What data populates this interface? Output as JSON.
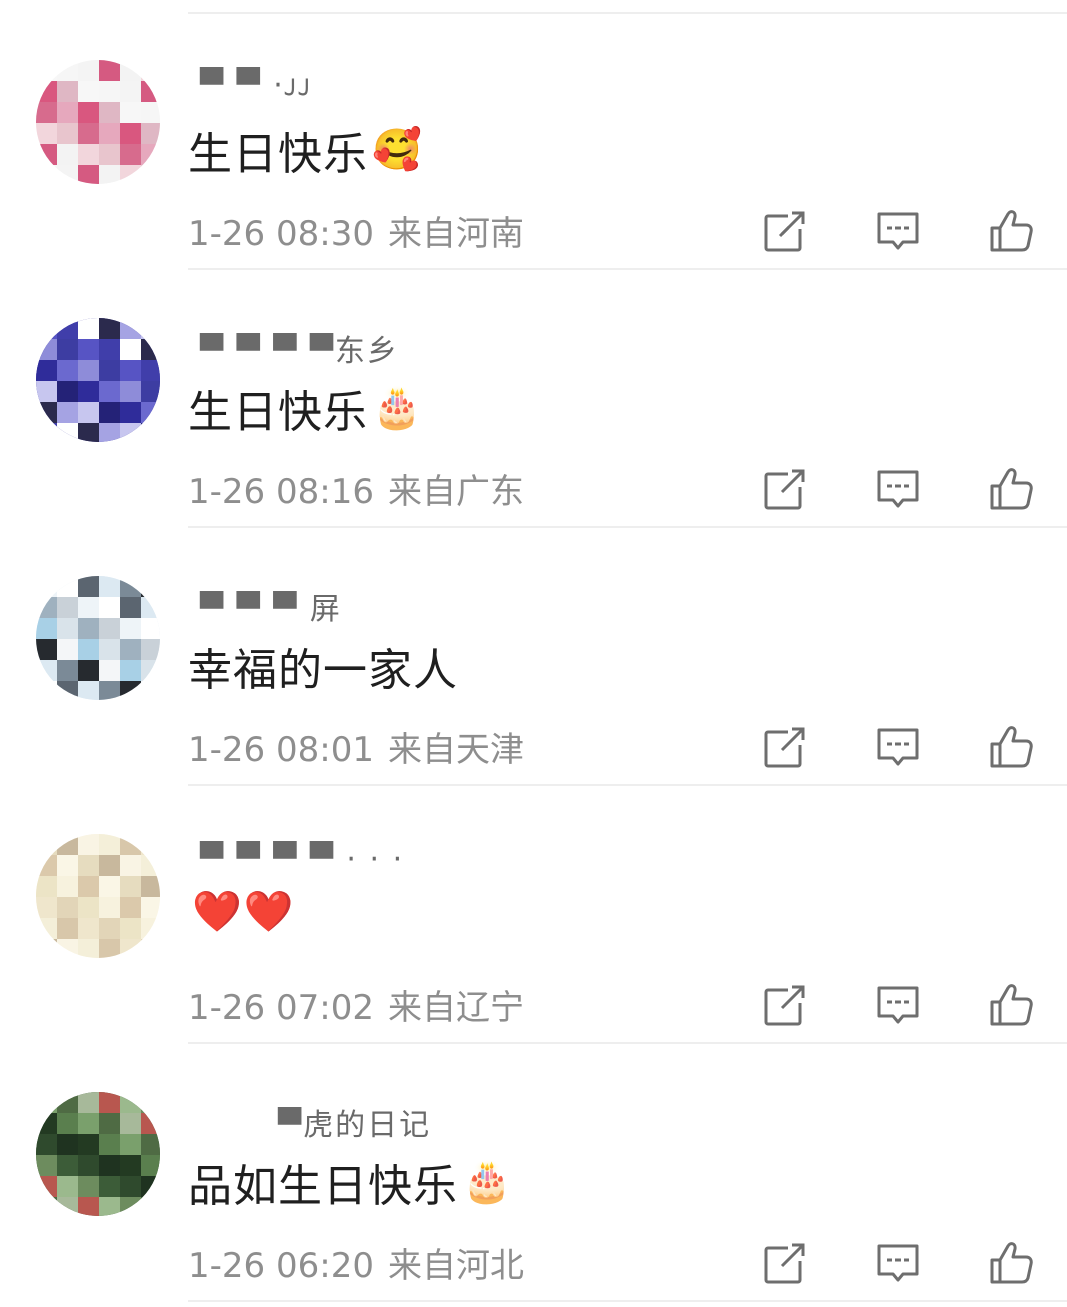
{
  "comments": [
    {
      "username": "▀ ▀ ·ᴊᴊ",
      "text": "生日快乐",
      "emoji": "🥰",
      "time": "1-26 08:30",
      "location": "来自河南",
      "avatar_colors": [
        "#f7f7f7",
        "#f3f3f3",
        "#e6a8bd",
        "#f6f6f6",
        "#f2d6dc",
        "#d9577f",
        "#f4f4f4",
        "#e8c5cd",
        "#dfb7c4",
        "#d55a81",
        "#d76b8d"
      ]
    },
    {
      "username": "▀ ▀ ▀ ▀东乡",
      "text": "生日快乐",
      "emoji": "🎂",
      "time": "1-26 08:16",
      "location": "来自广东",
      "avatar_colors": [
        "#2f2c9a",
        "#5754c4",
        "#a5a3e3",
        "#6b69cf",
        "#403eaa",
        "#c7c6ef",
        "#8e8cd9",
        "#ffffff",
        "#242277",
        "#3d3da2",
        "#2b2a4d"
      ]
    },
    {
      "username": "▀ ▀ ▀ 屏",
      "text": "幸福的一家人",
      "emoji": "",
      "time": "1-26 08:01",
      "location": "来自天津",
      "avatar_colors": [
        "#dce9f2",
        "#a8d0e6",
        "#eef4f8",
        "#7b8a97",
        "#d9e3ea",
        "#ffffff",
        "#262a2f",
        "#9fb1bf",
        "#5b6570",
        "#f4f6f8",
        "#c9d1d8"
      ]
    },
    {
      "username": "▀ ▀ ▀ ▀ · · ·",
      "text": "",
      "emoji": "❤️❤️",
      "time": "1-26 07:02",
      "location": "来自辽宁",
      "avatar_colors": [
        "#faf6e6",
        "#f4efd9",
        "#ece4c6",
        "#e6dcbf",
        "#d8c7aa",
        "#f7f2de",
        "#c8b89d",
        "#efe6cc",
        "#dbc9ab",
        "#f9f4e4",
        "#e2d5b8"
      ]
    },
    {
      "username": "▀虎的日记",
      "text": "品如生日快乐",
      "emoji": "🎂",
      "time": "1-26 06:20",
      "location": "来自河北",
      "avatar_colors": [
        "#3c5c38",
        "#5a7f4e",
        "#b8574f",
        "#2f4a2d",
        "#7aa06c",
        "#9bb98d",
        "#1f3320",
        "#4f6b44",
        "#6d8c5e",
        "#233a22",
        "#a7b99a"
      ]
    }
  ],
  "icons": [
    "share-icon",
    "comment-icon",
    "like-icon"
  ],
  "colors": {
    "text": "#1f1f1f",
    "meta": "#8e8e8e",
    "divider": "#eeeeee",
    "icon": "#6e6e6e"
  }
}
